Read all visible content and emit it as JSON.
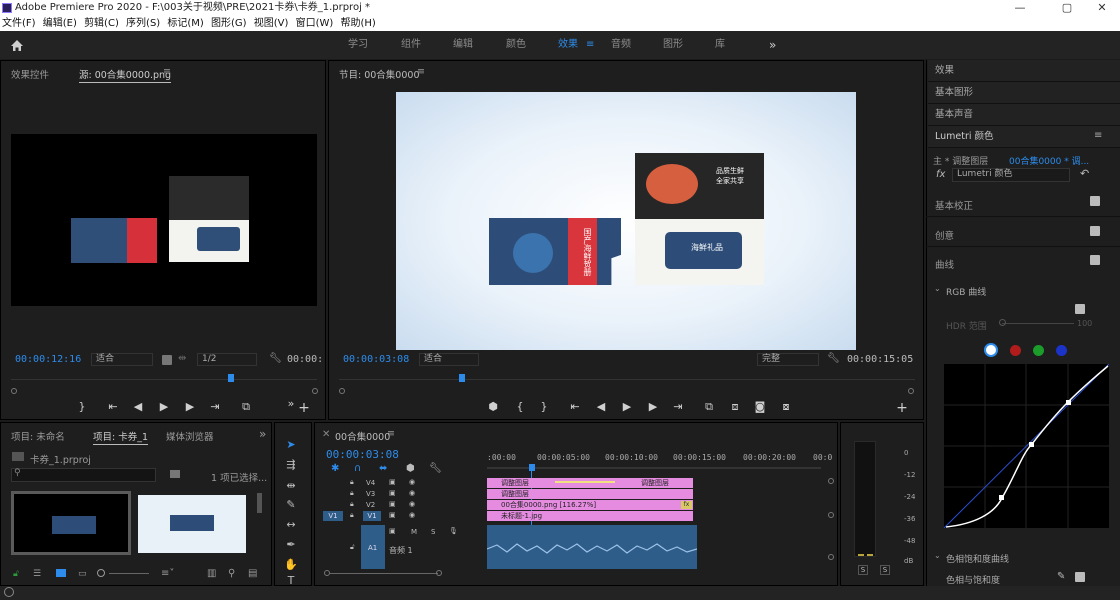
{
  "title_bar": {
    "title": "Adobe Premiere Pro 2020 - F:\\003关于视频\\PRE\\2021卡券\\卡券_1.prproj *",
    "minimize": "—",
    "maximize": "▢",
    "close": "✕"
  },
  "menu": [
    "文件(F)",
    "编辑(E)",
    "剪辑(C)",
    "序列(S)",
    "标记(M)",
    "图形(G)",
    "视图(V)",
    "窗口(W)",
    "帮助(H)"
  ],
  "workspaces": {
    "tabs": [
      "学习",
      "组件",
      "编辑",
      "颜色",
      "效果",
      "音频",
      "图形",
      "库"
    ],
    "active": "效果",
    "menu_icon": "≡",
    "more": "»"
  },
  "source_panel": {
    "tab_effect_controls": "效果控件",
    "tab_source": "源: 00合集0000.png",
    "menu_icon": "≡",
    "timecode": "00:00:12:16",
    "fit": "适合",
    "resolution": "1/2",
    "duration": "00:00:"
  },
  "program_panel": {
    "title": "节目: 00合集0000",
    "menu_icon": "≡",
    "timecode": "00:00:03:08",
    "fit": "适合",
    "quality": "完整",
    "duration": "00:00:15:05",
    "coupon_right_title": "品质生鲜\n全家共享",
    "coupon_gift_text": "海鲜礼品",
    "coupon_left_text": "国产海鲜贺册"
  },
  "project_panel": {
    "tab_unnamed": "项目: 未命名",
    "tab_project": "项目: 卡券_1",
    "tab_media": "媒体浏览器",
    "more": "»",
    "file": "卡券_1.prproj",
    "selected": "1 项已选择..."
  },
  "timeline": {
    "title": "00合集0000",
    "menu_icon": "≡",
    "timecode": "00:00:03:08",
    "ruler_labels": [
      ":00:00",
      "00:00:05:00",
      "00:00:10:00",
      "00:00:15:00",
      "00:00:20:00",
      "00:0"
    ],
    "tracks": {
      "v4": "V4",
      "v3": "V3",
      "v2": "V2",
      "v1": "V1",
      "v1_src": "V1",
      "a1": "A1",
      "a1_name": "音频 1",
      "m": "M",
      "s": "S"
    },
    "clips": {
      "adj1": "调整图层",
      "adj2": "调整图层",
      "adj3": "调整图层",
      "png": "00合集0000.png [116.27%]",
      "jpg": "未标题-1.jpg",
      "fx": "fx"
    }
  },
  "meter": {
    "scale": [
      "0",
      "-12",
      "-24",
      "-36",
      "-48",
      "dB"
    ],
    "s_left": "S",
    "s_right": "S"
  },
  "right_panel": {
    "effects": "效果",
    "basic_graphics": "基本图形",
    "basic_sound": "基本声音",
    "lumetri": "Lumetri 颜色",
    "menu_icon": "≡",
    "source_main": "主 * 调整图层",
    "source_seq": "00合集0000 * 调...",
    "fx_label": "fx",
    "fx_value": "Lumetri 颜色",
    "basic_correction": "基本校正",
    "creative": "创意",
    "curves": "曲线",
    "rgb_curves": "RGB 曲线",
    "hdr_range": "HDR 范围",
    "hdr_value": "100",
    "hue_sat_curves": "色相饱和度曲线",
    "hue_vs_sat": "色相与饱和度",
    "colors": {
      "white": "#ffffff",
      "red": "#b01c1c",
      "green": "#1c9c2a",
      "blue": "#1c33c8"
    }
  }
}
